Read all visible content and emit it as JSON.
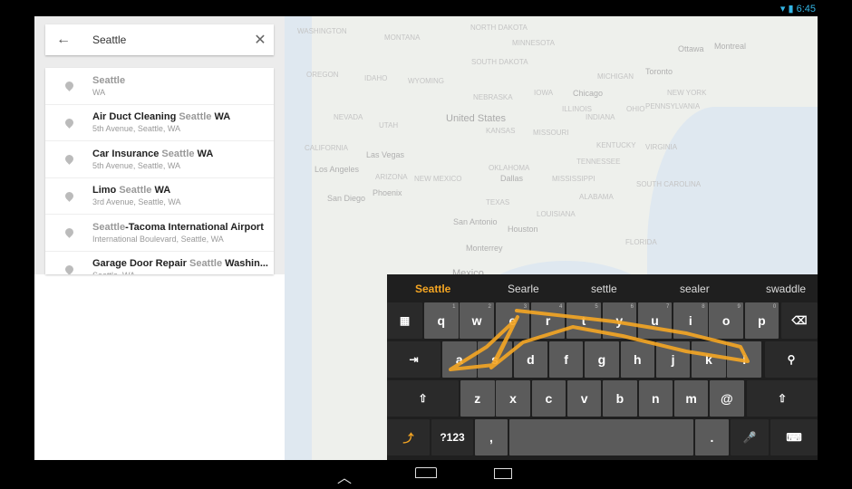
{
  "status": {
    "time": "6:45",
    "icons": [
      "wifi-icon",
      "battery-icon"
    ]
  },
  "search": {
    "query": "Seattle",
    "back_icon": "arrow-left-icon",
    "clear_icon": "close-icon"
  },
  "results": [
    {
      "parts": [
        {
          "t": "Seattle",
          "hl": true
        }
      ],
      "sub": "WA"
    },
    {
      "parts": [
        {
          "t": "Air Duct Cleaning ",
          "hl": false
        },
        {
          "t": "Seattle",
          "hl": true
        },
        {
          "t": " WA",
          "hl": false
        }
      ],
      "sub": "5th Avenue, Seattle, WA"
    },
    {
      "parts": [
        {
          "t": "Car Insurance ",
          "hl": false
        },
        {
          "t": "Seattle",
          "hl": true
        },
        {
          "t": " WA",
          "hl": false
        }
      ],
      "sub": "5th Avenue, Seattle, WA"
    },
    {
      "parts": [
        {
          "t": "Limo ",
          "hl": false
        },
        {
          "t": "Seattle",
          "hl": true
        },
        {
          "t": " WA",
          "hl": false
        }
      ],
      "sub": "3rd Avenue, Seattle, WA"
    },
    {
      "parts": [
        {
          "t": "Seattle",
          "hl": true
        },
        {
          "t": "-Tacoma International Airport",
          "hl": false
        }
      ],
      "sub": "International Boulevard, Seattle, WA"
    },
    {
      "parts": [
        {
          "t": "Garage Door Repair ",
          "hl": false
        },
        {
          "t": "Seattle",
          "hl": true
        },
        {
          "t": " Washin...",
          "hl": false
        }
      ],
      "sub": "Seattle, WA"
    }
  ],
  "map": {
    "labels": [
      {
        "t": "WASHINGTON",
        "c": ""
      },
      {
        "t": "MONTANA",
        "c": ""
      },
      {
        "t": "NORTH DAKOTA",
        "c": ""
      },
      {
        "t": "MINNESOTA",
        "c": ""
      },
      {
        "t": "Ottawa",
        "c": "city"
      },
      {
        "t": "Montreal",
        "c": "city"
      },
      {
        "t": "OREGON",
        "c": ""
      },
      {
        "t": "IDAHO",
        "c": ""
      },
      {
        "t": "WYOMING",
        "c": ""
      },
      {
        "t": "SOUTH DAKOTA",
        "c": ""
      },
      {
        "t": "MICHIGAN",
        "c": ""
      },
      {
        "t": "Toronto",
        "c": "city"
      },
      {
        "t": "NEBRASKA",
        "c": ""
      },
      {
        "t": "IOWA",
        "c": ""
      },
      {
        "t": "Chicago",
        "c": "city"
      },
      {
        "t": "NEW YORK",
        "c": ""
      },
      {
        "t": "ILLINOIS",
        "c": ""
      },
      {
        "t": "OHIO",
        "c": ""
      },
      {
        "t": "PENNSYLVANIA",
        "c": ""
      },
      {
        "t": "NEVADA",
        "c": ""
      },
      {
        "t": "United States",
        "c": "big"
      },
      {
        "t": "UTAH",
        "c": ""
      },
      {
        "t": "INDIANA",
        "c": ""
      },
      {
        "t": "KANSAS",
        "c": ""
      },
      {
        "t": "MISSOURI",
        "c": ""
      },
      {
        "t": "CALIFORNIA",
        "c": ""
      },
      {
        "t": "KENTUCKY",
        "c": ""
      },
      {
        "t": "VIRGINIA",
        "c": ""
      },
      {
        "t": "Las Vegas",
        "c": "city"
      },
      {
        "t": "Los Angeles",
        "c": "city"
      },
      {
        "t": "OKLAHOMA",
        "c": ""
      },
      {
        "t": "TENNESSEE",
        "c": ""
      },
      {
        "t": "ARIZONA",
        "c": ""
      },
      {
        "t": "NEW MEXICO",
        "c": ""
      },
      {
        "t": "Dallas",
        "c": "city"
      },
      {
        "t": "MISSISSIPPI",
        "c": ""
      },
      {
        "t": "SOUTH CAROLINA",
        "c": ""
      },
      {
        "t": "Phoenix",
        "c": "city"
      },
      {
        "t": "San Diego",
        "c": "city"
      },
      {
        "t": "ALABAMA",
        "c": ""
      },
      {
        "t": "TEXAS",
        "c": ""
      },
      {
        "t": "LOUISIANA",
        "c": ""
      },
      {
        "t": "San Antonio",
        "c": "city"
      },
      {
        "t": "Houston",
        "c": "city"
      },
      {
        "t": "FLORIDA",
        "c": ""
      },
      {
        "t": "Monterrey",
        "c": "city"
      },
      {
        "t": "Mexico",
        "c": "big"
      }
    ]
  },
  "keyboard": {
    "suggestions": [
      "Seattle",
      "Searle",
      "settle",
      "sealer",
      "swaddle"
    ],
    "accent": "#f5a623",
    "row1": [
      "q",
      "w",
      "e",
      "r",
      "t",
      "y",
      "u",
      "i",
      "o",
      "p"
    ],
    "row1_hints": [
      "1",
      "2",
      "3",
      "4",
      "5",
      "6",
      "7",
      "8",
      "9",
      "0"
    ],
    "row2": [
      "a",
      "s",
      "d",
      "f",
      "g",
      "h",
      "j",
      "k",
      "l"
    ],
    "row3": [
      "z",
      "x",
      "c",
      "v",
      "b",
      "n",
      "m",
      "@"
    ],
    "symbols_label": "?123",
    "comma": ",",
    "period": "."
  },
  "nav": {
    "icons": [
      "back-icon",
      "home-icon",
      "recents-icon"
    ]
  }
}
